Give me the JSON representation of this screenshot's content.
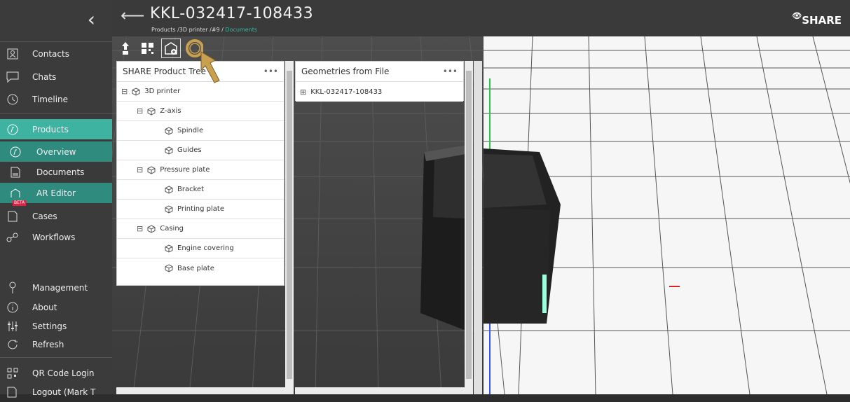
{
  "sidebar": {
    "collapse_icon": "chevron-left-icon",
    "items": [
      {
        "label": "Contacts",
        "icon": "contact-card-icon"
      },
      {
        "label": "Chats",
        "icon": "chat-bubble-icon"
      },
      {
        "label": "Timeline",
        "icon": "clock-icon"
      },
      {
        "label": "Products",
        "icon": "product-icon"
      },
      {
        "label": "Overview",
        "icon": "product-icon"
      },
      {
        "label": "Documents",
        "icon": "document-icon"
      },
      {
        "label": "AR Editor",
        "icon": "ar-editor-icon",
        "badge": "BETA"
      },
      {
        "label": "Cases",
        "icon": "case-icon"
      },
      {
        "label": "Workflows",
        "icon": "workflow-icon"
      },
      {
        "label": "Management",
        "icon": "pin-icon"
      },
      {
        "label": "About",
        "icon": "info-icon"
      },
      {
        "label": "Settings",
        "icon": "sliders-icon"
      },
      {
        "label": "Refresh",
        "icon": "refresh-icon"
      },
      {
        "label": "QR Code Login",
        "icon": "qr-icon"
      },
      {
        "label": "Logout (Mark T",
        "icon": "logout-icon"
      }
    ]
  },
  "header": {
    "title": "KKL-032417-108433",
    "crumb_path": "Products /3D printer /#9 /",
    "crumb_active": "Documents",
    "logo": "SHARE"
  },
  "panels": {
    "product_tree": {
      "title": "SHARE Product Tree",
      "menu": "•••",
      "rows": [
        {
          "label": "3D printer"
        },
        {
          "label": "Z-axis"
        },
        {
          "label": "Spindle"
        },
        {
          "label": "Guides"
        },
        {
          "label": "Pressure plate"
        },
        {
          "label": "Bracket"
        },
        {
          "label": "Printing plate"
        },
        {
          "label": "Casing"
        },
        {
          "label": "Engine covering"
        },
        {
          "label": "Base plate"
        }
      ]
    },
    "geometries": {
      "title": "Geometries from File",
      "menu": "•••",
      "rows": [
        {
          "label": "KKL-032417-108433"
        }
      ]
    }
  },
  "colors": {
    "accent": "#3fb3a2",
    "highlight": "#c9a050",
    "sidebar": "#3b3b3b"
  }
}
